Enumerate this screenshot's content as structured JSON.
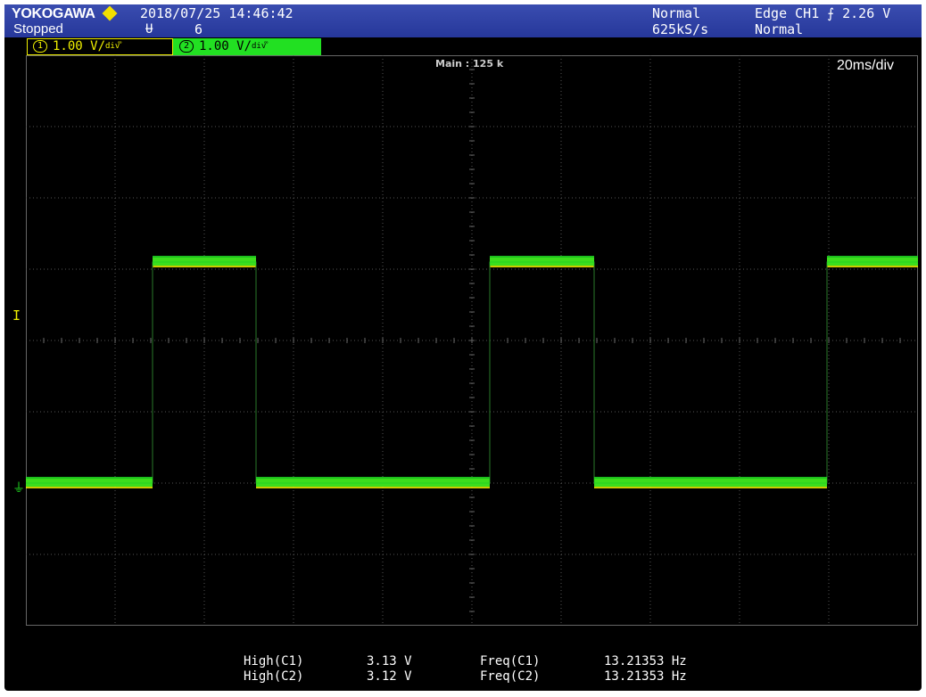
{
  "header": {
    "brand": "YOKOGAWA",
    "status": "Stopped",
    "datetime": "2018/07/25 14:46:42",
    "acquisition_icon": "Ʉ",
    "acquisition_count": "6",
    "mode": "Normal",
    "sample_rate": "625kS/s",
    "trigger": "Edge CH1 ⨍ 2.26 V",
    "trigger_mode": "Normal"
  },
  "channels": [
    {
      "num": "1",
      "scale": "1.00 V/",
      "unit": "div",
      "mark": "᪲",
      "color": "#f0f000"
    },
    {
      "num": "2",
      "scale": "1.00 V/",
      "unit": "div",
      "mark": "᪲",
      "color": "#22e022"
    }
  ],
  "display": {
    "main_label": "Main : 125 k",
    "time_div": "20ms/div",
    "trigger_marker": "I",
    "ground_marker": "⏚"
  },
  "measurements": [
    {
      "name": "High(C1)",
      "value": "3.13 V",
      "fname": "Freq(C1)",
      "fvalue": "13.21353 Hz"
    },
    {
      "name": "High(C2)",
      "value": "3.12 V",
      "fname": "Freq(C2)",
      "fvalue": "13.21353 Hz"
    }
  ],
  "chart_data": {
    "type": "line",
    "xlabel": "",
    "ylabel": "",
    "x_divisions": 10,
    "y_divisions": 8,
    "time_per_div_ms": 20,
    "volts_per_div": 1.0,
    "series": [
      {
        "color": "#f0f000",
        "points_div": [
          [
            0,
            0.0
          ],
          [
            1.42,
            0.0
          ],
          [
            1.42,
            3.1
          ],
          [
            2.58,
            3.1
          ],
          [
            2.58,
            0.0
          ],
          [
            5.2,
            0.0
          ],
          [
            5.2,
            3.1
          ],
          [
            6.37,
            3.1
          ],
          [
            6.37,
            0.0
          ],
          [
            8.98,
            0.0
          ],
          [
            8.98,
            3.1
          ],
          [
            10,
            3.1
          ]
        ]
      },
      {
        "color": "#22e022",
        "points_div": [
          [
            0,
            0.0
          ],
          [
            1.42,
            0.0
          ],
          [
            1.42,
            3.1
          ],
          [
            2.58,
            3.1
          ],
          [
            2.58,
            0.0
          ],
          [
            5.2,
            0.0
          ],
          [
            5.2,
            3.1
          ],
          [
            6.37,
            3.1
          ],
          [
            6.37,
            0.0
          ],
          [
            8.98,
            0.0
          ],
          [
            8.98,
            3.1
          ],
          [
            10,
            3.1
          ]
        ]
      }
    ]
  }
}
